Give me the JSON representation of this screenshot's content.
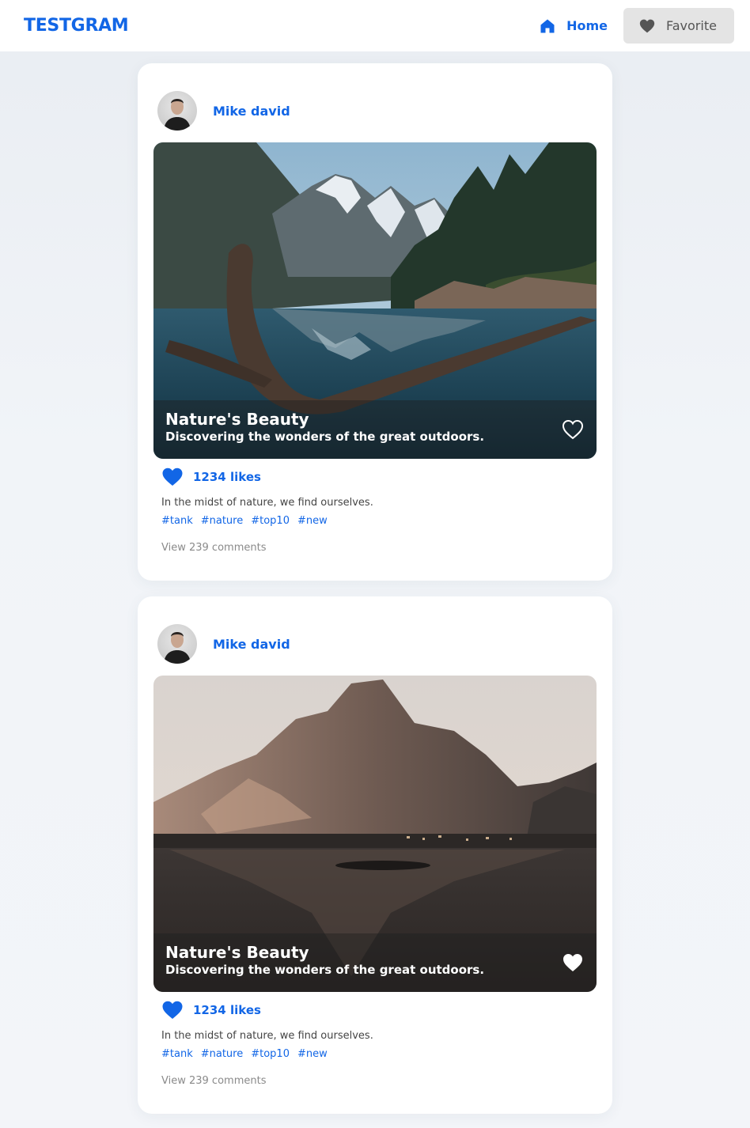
{
  "app": {
    "brand": "TESTGRAM",
    "accent_color": "#1266e6"
  },
  "nav": {
    "home": {
      "label": "Home",
      "icon": "home-icon"
    },
    "favorite": {
      "label": "Favorite",
      "icon": "heart-icon"
    }
  },
  "posts": [
    {
      "author": "Mike david",
      "image_title": "Nature's Beauty",
      "image_subtitle": "Discovering the wonders of the great outdoors.",
      "favorited": false,
      "likes": "1234 likes",
      "description": "In the midst of nature, we find ourselves.",
      "tags": [
        "#tank",
        "#nature",
        "#top10",
        "#new"
      ],
      "comments": "View 239 comments"
    },
    {
      "author": "Mike david",
      "image_title": "Nature's Beauty",
      "image_subtitle": "Discovering the wonders of the great outdoors.",
      "favorited": true,
      "likes": "1234 likes",
      "description": "In the midst of nature, we find ourselves.",
      "tags": [
        "#tank",
        "#nature",
        "#top10",
        "#new"
      ],
      "comments": "View 239 comments"
    }
  ]
}
